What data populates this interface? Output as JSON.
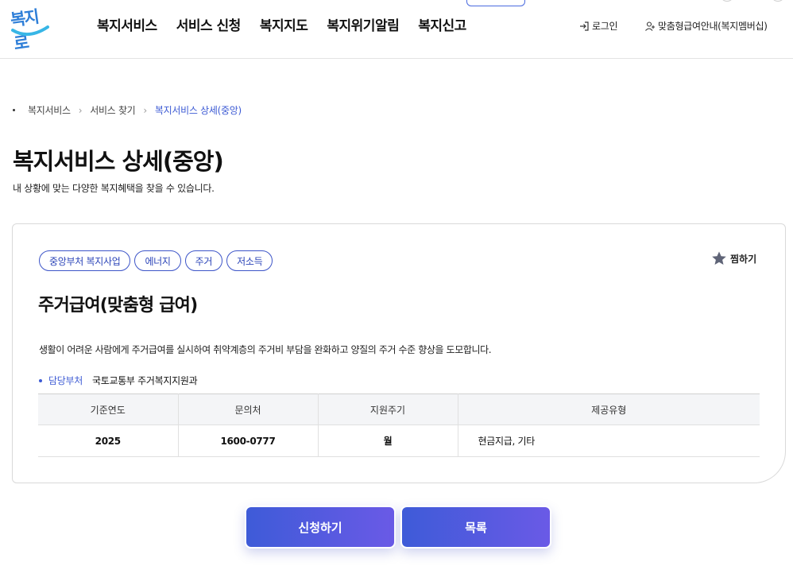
{
  "header": {
    "logo_text": "복지로",
    "nav": [
      "복지서비스",
      "서비스 신청",
      "복지지도",
      "복지위기알림",
      "복지신고"
    ],
    "login_label": "로그인",
    "member_label": "맞춤형급여안내(복지멤버십)"
  },
  "breadcrumb": [
    "복지서비스",
    "서비스 찾기",
    "복지서비스 상세(중앙)"
  ],
  "page": {
    "title": "복지서비스 상세(중앙)",
    "subtitle": "내 상황에 맞는 다양한 복지혜택을 찾을 수 있습니다."
  },
  "service": {
    "tags": [
      "중앙부처 복지사업",
      "에너지",
      "주거",
      "저소득"
    ],
    "favorite_label": "찜하기",
    "title": "주거급여(맞춤형 급여)",
    "description": "생활이 어려운 사람에게 주거급여를 실시하여 취약계층의 주거비 부담을 완화하고 양질의 주거 수준 향상을 도모합니다.",
    "dept_label": "담당부처",
    "dept_value": "국토교통부 주거복지지원과",
    "table": {
      "headers": [
        "기준연도",
        "문의처",
        "지원주기",
        "제공유형"
      ],
      "row": [
        "2025",
        "1600-0777",
        "월",
        "현금지급, 기타"
      ]
    }
  },
  "buttons": {
    "apply": "신청하기",
    "list": "목록"
  },
  "colors": {
    "accent": "#3d5bd4",
    "button_gradient_start": "#3e5bd8",
    "button_gradient_end": "#6a5ae6"
  },
  "icons": [
    "login-icon",
    "user-plus-icon",
    "star-icon"
  ]
}
